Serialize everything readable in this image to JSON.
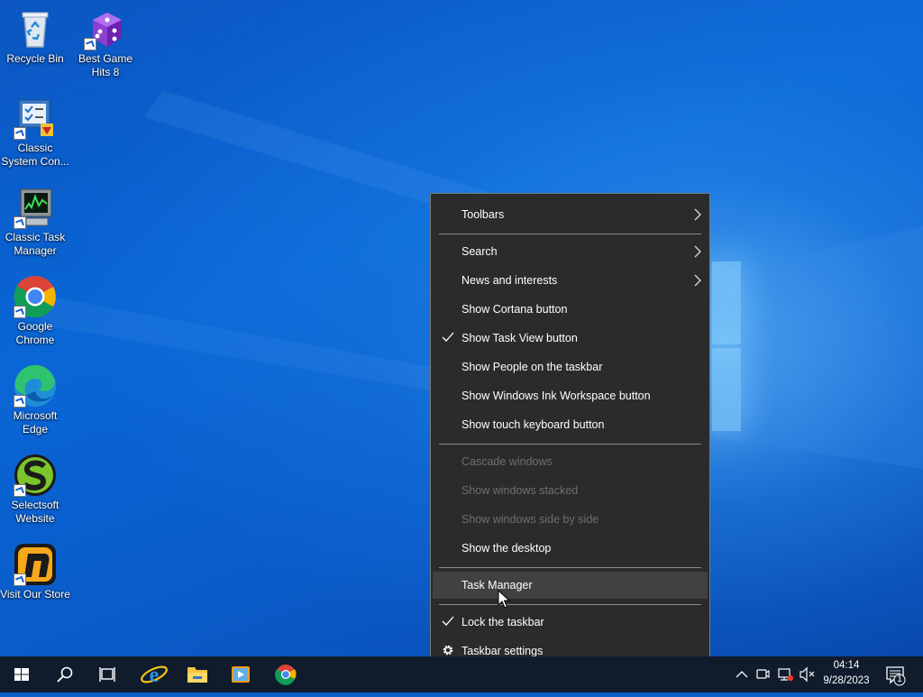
{
  "desktop": {
    "icons": [
      {
        "label": "Recycle Bin",
        "icon": "recycle-bin-icon"
      },
      {
        "label": "Best Game Hits 8",
        "icon": "game-dice-icon"
      },
      {
        "label": "Classic System Con...",
        "icon": "control-panel-icon"
      },
      {
        "label": "Classic Task Manager",
        "icon": "task-manager-icon"
      },
      {
        "label": "Google Chrome",
        "icon": "chrome-icon"
      },
      {
        "label": "Microsoft Edge",
        "icon": "edge-icon"
      },
      {
        "label": "Selectsoft Website",
        "icon": "selectsoft-icon"
      },
      {
        "label": "Visit Our Store",
        "icon": "store-icon"
      }
    ]
  },
  "context_menu": {
    "items": [
      {
        "label": "Toolbars",
        "submenu": true
      },
      {
        "label": "Search",
        "submenu": true
      },
      {
        "label": "News and interests",
        "submenu": true
      },
      {
        "label": "Show Cortana button"
      },
      {
        "label": "Show Task View button",
        "checked": true
      },
      {
        "label": "Show People on the taskbar"
      },
      {
        "label": "Show Windows Ink Workspace button"
      },
      {
        "label": "Show touch keyboard button"
      },
      {
        "label": "Cascade windows",
        "disabled": true
      },
      {
        "label": "Show windows stacked",
        "disabled": true
      },
      {
        "label": "Show windows side by side",
        "disabled": true
      },
      {
        "label": "Show the desktop"
      },
      {
        "label": "Task Manager",
        "highlighted": true
      },
      {
        "label": "Lock the taskbar",
        "checked": true
      },
      {
        "label": "Taskbar settings",
        "icon": "gear-icon"
      }
    ]
  },
  "taskbar": {
    "buttons": [
      "start-icon",
      "search-icon",
      "task-view-icon",
      "internet-explorer-icon",
      "file-explorer-icon",
      "media-player-icon",
      "chrome-icon"
    ],
    "tray": {
      "time": "04:14",
      "date": "9/28/2023",
      "notification_count": "1"
    }
  },
  "colors": {
    "menu_bg": "#2b2b2b",
    "menu_hover": "#414141",
    "taskbar_bg": "#101c2c",
    "desktop_blue": "#0a5fc8"
  }
}
